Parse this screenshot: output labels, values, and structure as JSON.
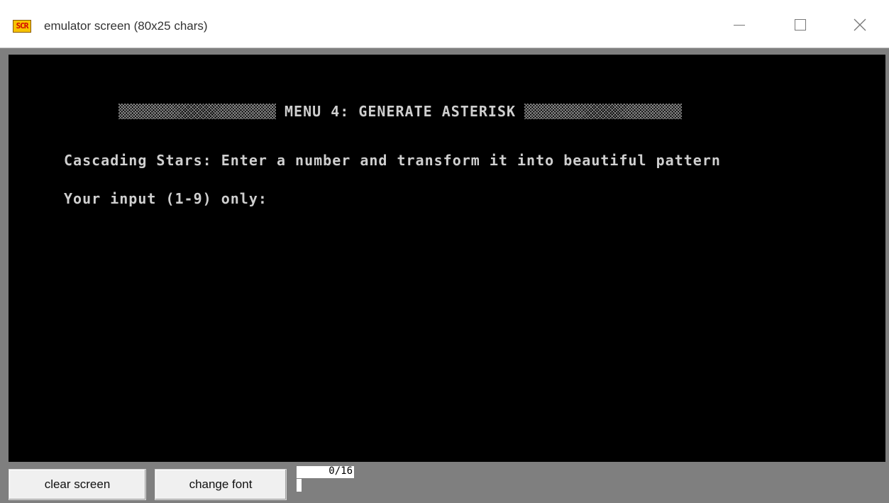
{
  "window": {
    "icon_text": "SCR",
    "title": "emulator screen (80x25 chars)",
    "icons": {
      "app": "app-icon",
      "minimize": "minimize-icon",
      "maximize": "maximize-icon",
      "close": "close-icon"
    }
  },
  "console": {
    "header": "MENU 4: GENERATE ASTERISK",
    "description": "Cascading Stars: Enter a number and transform it into beautiful pattern",
    "prompt": "Your input (1-9) only:"
  },
  "bottom": {
    "clear_label": "clear screen",
    "font_label": "change font",
    "counter": "0/16"
  },
  "colors": {
    "console_bg": "#000000",
    "console_text": "#cfcfcf",
    "bottom_bar": "#7f7f7f"
  }
}
